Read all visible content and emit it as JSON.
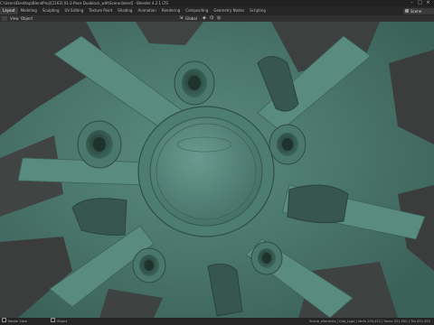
{
  "window": {
    "title": "C:\\Users\\Desktop\\BlendProj\\[2163] 01-2-Pace Duablock_withScene.blend] - Blender 4.2.1 LTS",
    "icons": [
      "minimize-icon",
      "maximize-icon",
      "close-icon"
    ]
  },
  "workspace_tabs": [
    {
      "label": "Layout",
      "active": true
    },
    {
      "label": "Modeling",
      "active": false
    },
    {
      "label": "Sculpting",
      "active": false
    },
    {
      "label": "UV Editing",
      "active": false
    },
    {
      "label": "Texture Paint",
      "active": false
    },
    {
      "label": "Shading",
      "active": false
    },
    {
      "label": "Animation",
      "active": false
    },
    {
      "label": "Rendering",
      "active": false
    },
    {
      "label": "Compositing",
      "active": false
    },
    {
      "label": "Geometry Nodes",
      "active": false
    },
    {
      "label": "Scripting",
      "active": false
    }
  ],
  "scene_selector": {
    "value": "Scene",
    "icon": "scene-icon"
  },
  "viewport_header": {
    "view_menu": "View",
    "object_menu": "Object",
    "orientation": "Global",
    "icons": [
      "editor-type-icon",
      "transform-orientation-icon",
      "pivot-icon",
      "snap-icon",
      "proportional-edit-icon"
    ]
  },
  "viewport": {
    "mesh_color": "#4f7d72",
    "mesh_shadow": "#2f4f48",
    "background": "#3a3d3c"
  },
  "statusbar": {
    "left_items": [
      "Rotate View",
      "Object"
    ],
    "info": "Scene_elements | Cab_Logo | Verts 290,412 | Faces 331,500 | Tris 651,352"
  }
}
